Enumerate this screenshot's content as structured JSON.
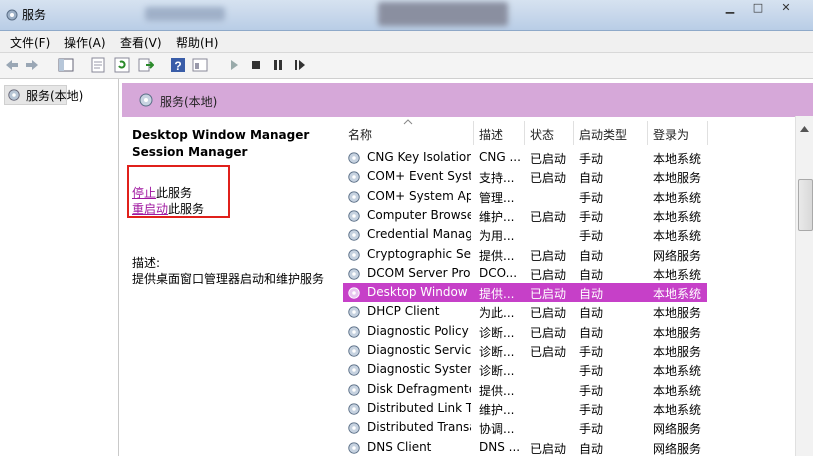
{
  "window": {
    "title": "服务",
    "minimize": "▁",
    "maximize": "□",
    "close": "✕"
  },
  "menu": [
    "文件(F)",
    "操作(A)",
    "查看(V)",
    "帮助(H)"
  ],
  "toolbar": {
    "icons": [
      "back-arrow-icon",
      "forward-arrow-icon",
      "show-tree-icon",
      "properties-icon",
      "refresh-icon",
      "export-icon",
      "help-icon",
      "console-icon",
      "start-icon",
      "stop-icon",
      "pause-icon",
      "restart-icon"
    ]
  },
  "tree": {
    "item": "服务(本地)"
  },
  "header": {
    "title": "服务(本地)"
  },
  "description": {
    "service_name": "Desktop Window Manager Session Manager",
    "stop_link": "停止",
    "stop_suffix": "此服务",
    "restart_link": "重启动",
    "restart_suffix": "此服务",
    "desc_label": "描述:",
    "desc_text": "提供桌面窗口管理器启动和维护服务"
  },
  "columns": [
    "名称",
    "描述",
    "状态",
    "启动类型",
    "登录为"
  ],
  "rows": [
    {
      "name": "CNG Key Isolation",
      "desc": "CNG ...",
      "status": "已启动",
      "startup": "手动",
      "logon": "本地系统"
    },
    {
      "name": "COM+ Event Syst...",
      "desc": "支持...",
      "status": "已启动",
      "startup": "自动",
      "logon": "本地服务"
    },
    {
      "name": "COM+ System Ap...",
      "desc": "管理...",
      "status": "",
      "startup": "手动",
      "logon": "本地系统"
    },
    {
      "name": "Computer Browser",
      "desc": "维护...",
      "status": "已启动",
      "startup": "手动",
      "logon": "本地系统"
    },
    {
      "name": "Credential Manager",
      "desc": "为用...",
      "status": "",
      "startup": "手动",
      "logon": "本地系统"
    },
    {
      "name": "Cryptographic Ser...",
      "desc": "提供...",
      "status": "已启动",
      "startup": "自动",
      "logon": "网络服务"
    },
    {
      "name": "DCOM Server Pro...",
      "desc": "DCO...",
      "status": "已启动",
      "startup": "自动",
      "logon": "本地系统"
    },
    {
      "name": "Desktop Window ...",
      "desc": "提供...",
      "status": "已启动",
      "startup": "自动",
      "logon": "本地系统",
      "selected": true
    },
    {
      "name": "DHCP Client",
      "desc": "为此...",
      "status": "已启动",
      "startup": "自动",
      "logon": "本地服务"
    },
    {
      "name": "Diagnostic Policy ...",
      "desc": "诊断...",
      "status": "已启动",
      "startup": "自动",
      "logon": "本地服务"
    },
    {
      "name": "Diagnostic Service...",
      "desc": "诊断...",
      "status": "已启动",
      "startup": "手动",
      "logon": "本地服务"
    },
    {
      "name": "Diagnostic System...",
      "desc": "诊断...",
      "status": "",
      "startup": "手动",
      "logon": "本地系统"
    },
    {
      "name": "Disk Defragmenter",
      "desc": "提供...",
      "status": "",
      "startup": "手动",
      "logon": "本地系统"
    },
    {
      "name": "Distributed Link Tr...",
      "desc": "维护...",
      "status": "",
      "startup": "手动",
      "logon": "本地系统"
    },
    {
      "name": "Distributed Transa...",
      "desc": "协调...",
      "status": "",
      "startup": "手动",
      "logon": "网络服务"
    },
    {
      "name": "DNS Client",
      "desc": "DNS ...",
      "status": "已启动",
      "startup": "自动",
      "logon": "网络服务"
    }
  ],
  "colors": {
    "accent": "#c640c8",
    "header_bg": "#d6a8d9",
    "highlight_box": "#e0201b"
  }
}
